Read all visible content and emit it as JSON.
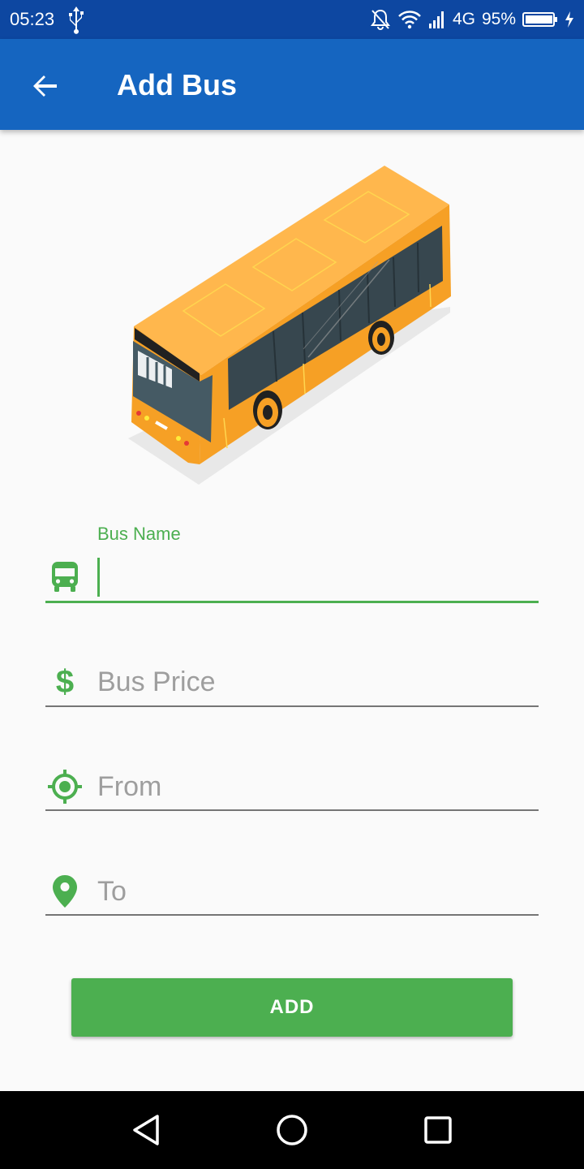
{
  "status_bar": {
    "time": "05:23",
    "network": "4G",
    "battery": "95%",
    "icons": [
      "usb-icon",
      "bell-off-icon",
      "wifi-icon",
      "signal-icon",
      "battery-icon",
      "charging-icon"
    ]
  },
  "app_bar": {
    "title": "Add Bus",
    "back_icon": "arrow-back-icon",
    "color": "#1565c0",
    "status_color": "#0d47a1"
  },
  "illustration": "bus-illustration",
  "form": {
    "bus_name": {
      "label": "Bus Name",
      "value": "",
      "icon": "bus-icon"
    },
    "bus_price": {
      "placeholder": "Bus Price",
      "value": "",
      "icon": "dollar-icon"
    },
    "from": {
      "placeholder": "From",
      "value": "",
      "icon": "my-location-icon"
    },
    "to": {
      "placeholder": "To",
      "value": "",
      "icon": "location-pin-icon"
    },
    "accent_color": "#4caf50"
  },
  "add_button": {
    "label": "ADD",
    "color": "#4caf50"
  },
  "nav_bar": {
    "icons": [
      "back-triangle-icon",
      "home-circle-icon",
      "recents-square-icon"
    ]
  }
}
